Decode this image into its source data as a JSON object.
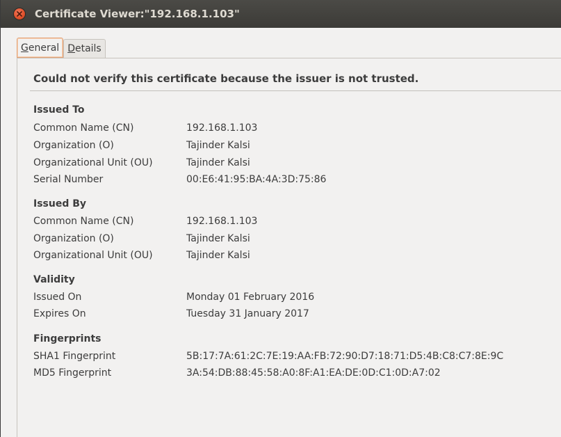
{
  "window": {
    "title": "Certificate Viewer:\"192.168.1.103\""
  },
  "tabs": {
    "general": {
      "mnemonic": "G",
      "rest": "eneral"
    },
    "details": {
      "mnemonic": "D",
      "rest": "etails"
    }
  },
  "warning": "Could not verify this certificate because the issuer is not trusted.",
  "issued_to": {
    "title": "Issued To",
    "rows": [
      {
        "label": "Common Name (CN)",
        "value": "192.168.1.103"
      },
      {
        "label": "Organization (O)",
        "value": "Tajinder Kalsi"
      },
      {
        "label": "Organizational Unit (OU)",
        "value": "Tajinder Kalsi"
      },
      {
        "label": "Serial Number",
        "value": "00:E6:41:95:BA:4A:3D:75:86"
      }
    ]
  },
  "issued_by": {
    "title": "Issued By",
    "rows": [
      {
        "label": "Common Name (CN)",
        "value": "192.168.1.103"
      },
      {
        "label": "Organization (O)",
        "value": "Tajinder Kalsi"
      },
      {
        "label": "Organizational Unit (OU)",
        "value": "Tajinder Kalsi"
      }
    ]
  },
  "validity": {
    "title": "Validity",
    "rows": [
      {
        "label": "Issued On",
        "value": "Monday 01 February 2016"
      },
      {
        "label": "Expires On",
        "value": "Tuesday 31 January 2017"
      }
    ]
  },
  "fingerprints": {
    "title": "Fingerprints",
    "rows": [
      {
        "label": "SHA1 Fingerprint",
        "value": "5B:17:7A:61:2C:7E:19:AA:FB:72:90:D7:18:71:D5:4B:C8:C7:8E:9C"
      },
      {
        "label": "MD5 Fingerprint",
        "value": "3A:54:DB:88:45:58:A0:8F:A1:EA:DE:0D:C1:0D:A7:02"
      }
    ]
  },
  "colors": {
    "titlebar": "#3c3b37",
    "close_button": "#e0502a",
    "active_tab_border": "#e3a275"
  }
}
